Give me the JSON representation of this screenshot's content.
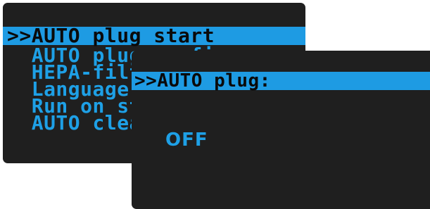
{
  "menu": {
    "items": [
      {
        "label": ">>AUTO plug start",
        "selected": true
      },
      {
        "label": "  AUTO plug config"
      },
      {
        "label": "  HEPA-filter"
      },
      {
        "label": "  Language"
      },
      {
        "label": "  Run on start"
      },
      {
        "label": "  AUTO clean"
      }
    ]
  },
  "dialog": {
    "title": ">>AUTO plug:",
    "value": "OFF"
  },
  "colors": {
    "screen_bg": "#1f1f1f",
    "accent": "#1e9be3",
    "text": "#1ea0e6"
  }
}
